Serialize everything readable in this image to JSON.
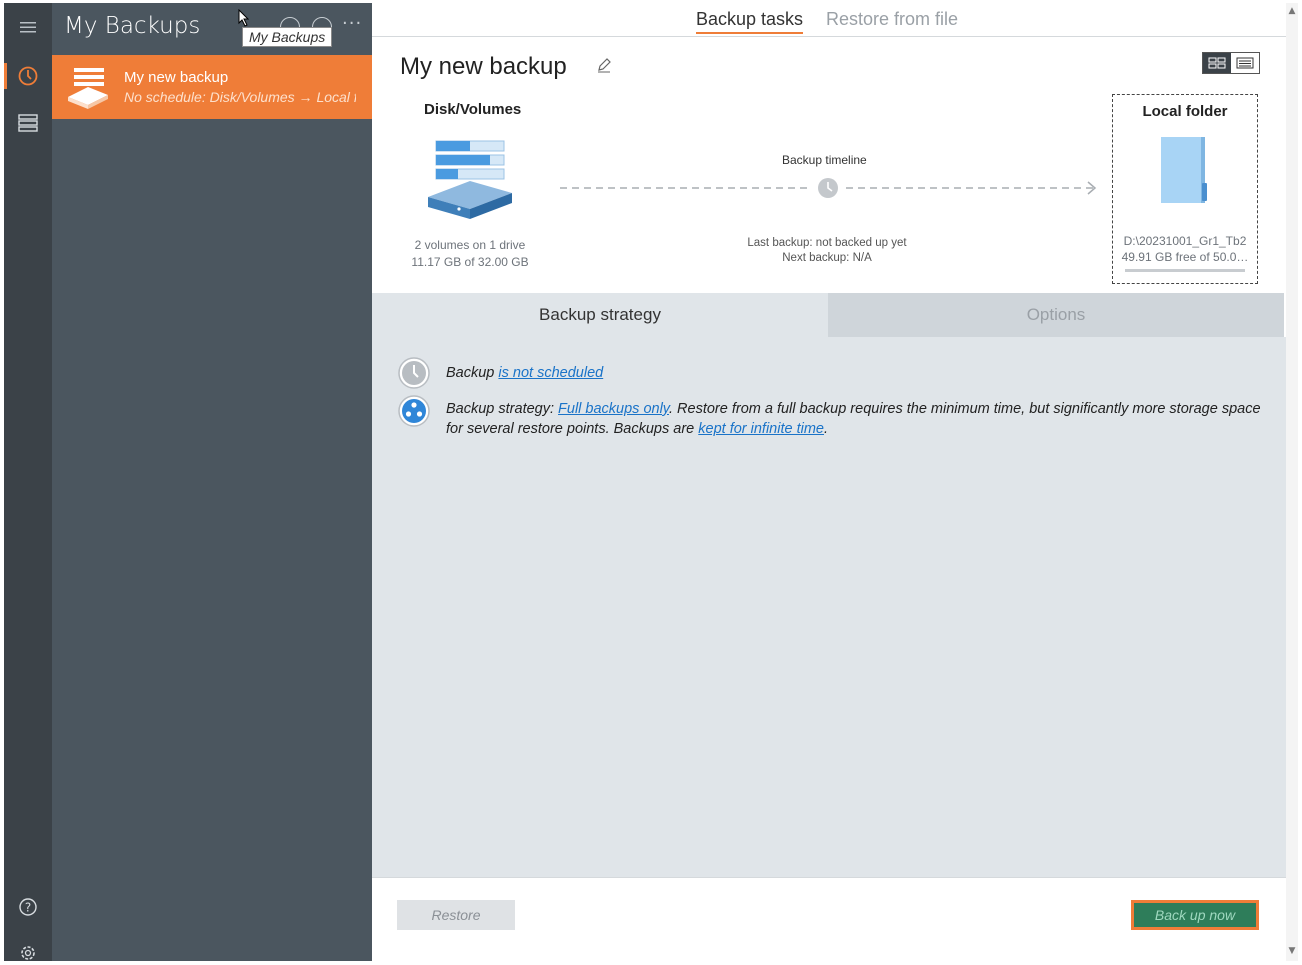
{
  "sidebar": {
    "title": "My Backups",
    "tooltip": "My Backups",
    "more": "···",
    "items": [
      {
        "name": "My new backup",
        "description": "No schedule: Disk/Volumes → Local folder"
      }
    ]
  },
  "tabs": {
    "backup_tasks": "Backup tasks",
    "restore_from_file": "Restore from file"
  },
  "task": {
    "title": "My new backup",
    "source": {
      "label": "Disk/Volumes",
      "line1": "2 volumes on 1 drive",
      "line2": "11.17 GB of 32.00 GB"
    },
    "timeline": {
      "label": "Backup timeline",
      "last_backup": "Last backup: not backed up yet",
      "next_backup": "Next backup: N/A"
    },
    "destination": {
      "label": "Local folder",
      "path": "D:\\20231001_Gr1_Tb2",
      "free": "49.91 GB free of 50.0…"
    }
  },
  "subtabs": {
    "strategy": "Backup strategy",
    "options": "Options"
  },
  "strategy": {
    "schedule_prefix": "Backup ",
    "schedule_link": "is not scheduled",
    "strategy_prefix": "Backup strategy: ",
    "strategy_link": "Full backups only",
    "strategy_middle": ". Restore from a full backup requires the minimum time, but significantly more storage space for several restore points. Backups are ",
    "retention_link": "kept for infinite time",
    "strategy_suffix": "."
  },
  "footer": {
    "restore": "Restore",
    "backup_now": "Back up now"
  },
  "colors": {
    "accent": "#ef7d38",
    "rail": "#3b4248",
    "panel": "#4b565f",
    "link": "#1a73c8",
    "strategy_bg": "#e0e5e9"
  },
  "icons": [
    "menu-icon",
    "history-icon",
    "drive-stack-icon",
    "help-icon",
    "settings-icon",
    "edit-icon",
    "clock-icon",
    "full-backup-icon"
  ]
}
